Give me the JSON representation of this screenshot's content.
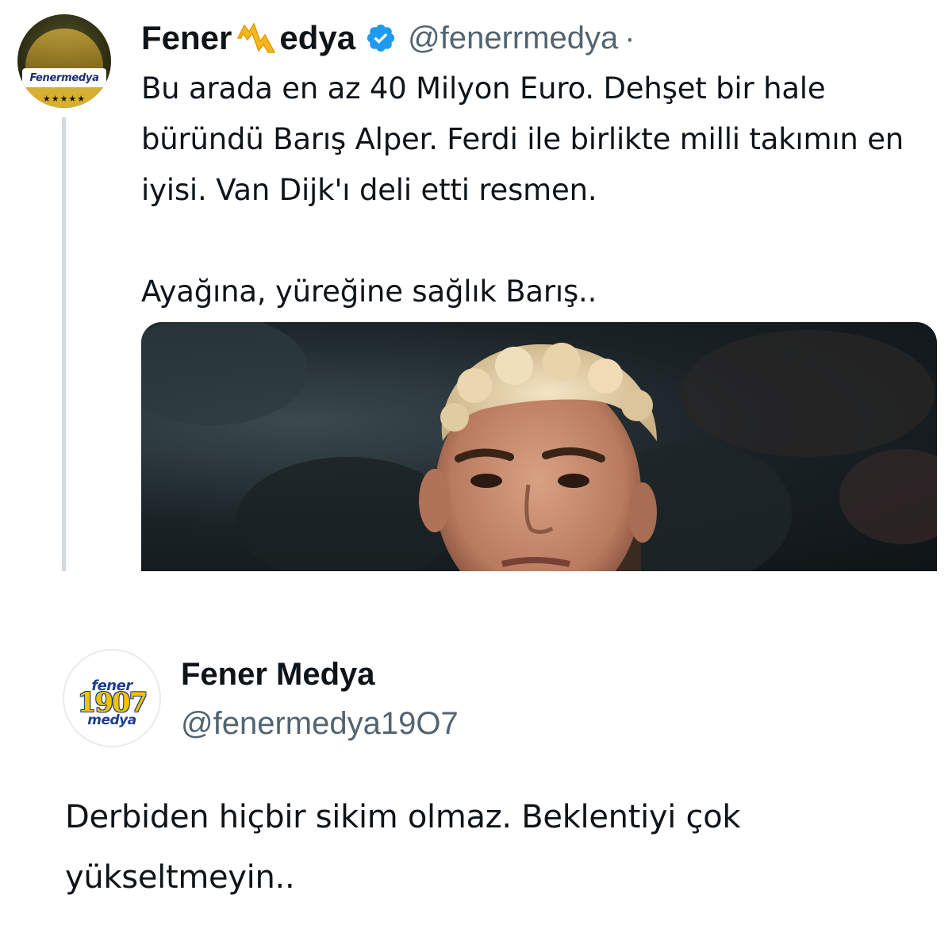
{
  "quoted_tweet": {
    "author": {
      "name_before_emoji": "Fener",
      "name_emoji": "lightning-m-emoji",
      "name_after_emoji": "edya",
      "verified": true,
      "handle": "@fenerrmedya",
      "separator": "·",
      "avatar_icon": "fenermedya-logo-icon",
      "avatar_text": "Fenermedya",
      "avatar_stars": "★★★★★"
    },
    "text": "Bu arada en az 40 Milyon Euro. Dehşet bir hale büründü Barış Alper. Ferdi ile birlikte milli takımın en iyisi. Van Dijk'ı deli etti resmen.\n\nAyağına, yüreğine sağlık Barış..",
    "media": {
      "type": "photo",
      "subject": "football-player-photo"
    }
  },
  "reply_tweet": {
    "author": {
      "name": "Fener Medya",
      "handle": "@fenermedya19O7",
      "avatar_icon": "fener-1907-medya-logo-icon",
      "avatar_top": "fener",
      "avatar_mid": "1907",
      "avatar_bot": "medya"
    },
    "text": "Derbiden hiçbir sikim olmaz. Beklentiyi çok yükseltmeyin.."
  },
  "colors": {
    "text_primary": "#0f1419",
    "text_secondary": "#536471",
    "verified_blue": "#1d9bf0",
    "thread_line": "#cfd9de",
    "background": "#ffffff"
  }
}
